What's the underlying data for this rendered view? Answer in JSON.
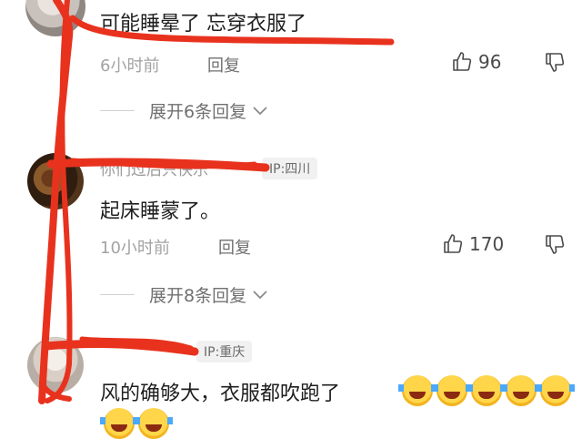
{
  "comments": [
    {
      "username": "",
      "text": "可能睡晕了 忘穿衣服了",
      "time": "6小时前",
      "reply_label": "回复",
      "likes": "96",
      "expand_label": "展开6条回复"
    },
    {
      "username": "你们过后只快乐",
      "ip": "IP:四川",
      "text": "起床睡蒙了。",
      "time": "10小时前",
      "reply_label": "回复",
      "likes": "170",
      "expand_label": "展开8条回复"
    },
    {
      "username": "",
      "ip": "IP:重庆",
      "text": "风的确够大，衣服都吹跑了"
    }
  ],
  "colors": {
    "scribble": "#e8321e",
    "meta": "#a3a3a3",
    "text": "#1f1f1f"
  },
  "icons": [
    "thumb-up-icon",
    "thumb-down-icon",
    "chevron-down-icon",
    "rolling-laugh-emoji"
  ]
}
